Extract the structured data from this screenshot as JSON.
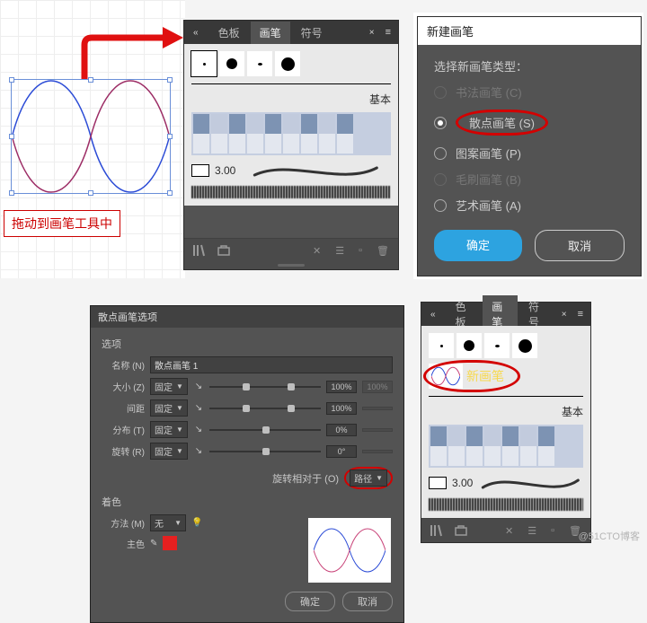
{
  "hint": {
    "drag_to_brush_tool": "拖动到画笔工具中"
  },
  "brush_panel": {
    "tabs": {
      "swatches": "色板",
      "brushes": "画笔",
      "symbols": "符号"
    },
    "basic_label": "基本",
    "stroke_weight": "3.00",
    "new_brush_label": "新画笔"
  },
  "new_brush_dialog": {
    "title": "新建画笔",
    "header": "选择新画笔类型：",
    "opts": {
      "calligraphic": "书法画笔 (C)",
      "scatter": "散点画笔 (S)",
      "pattern": "图案画笔 (P)",
      "bristle": "毛刷画笔 (B)",
      "artistic": "艺术画笔 (A)"
    },
    "ok": "确定",
    "cancel": "取消"
  },
  "options_dialog": {
    "title": "散点画笔选项",
    "section_options": "选项",
    "labels": {
      "name": "名称 (N)",
      "size": "大小 (Z)",
      "spacing": "间距",
      "scatter": "分布 (T)",
      "rotation": "旋转 (R)",
      "rotate_rel": "旋转相对于 (O)",
      "fixed": "固定",
      "path": "路径"
    },
    "name_value": "散点画笔 1",
    "values": {
      "size": "100%",
      "spacing": "100%",
      "scatter": "0%",
      "rotation": "0°"
    },
    "section_color": "着色",
    "labels_color": {
      "method": "方法 (M)",
      "none": "无",
      "keycolor": "主色"
    },
    "ok": "确定",
    "cancel": "取消"
  },
  "watermark": "@51CTO博客"
}
